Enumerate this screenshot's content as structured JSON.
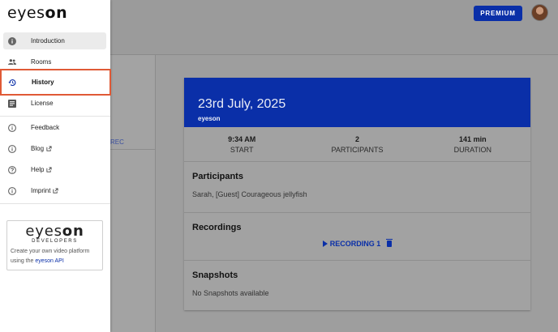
{
  "header": {
    "premium_label": "PREMIUM"
  },
  "background": {
    "rec_label": "REC"
  },
  "logo": {
    "prefix": "eyes",
    "suffix": "on"
  },
  "sidebar": {
    "items": [
      {
        "label": "Introduction",
        "icon": "info-filled-icon",
        "active": true
      },
      {
        "label": "Rooms",
        "icon": "people-icon"
      },
      {
        "label": "History",
        "icon": "history-icon",
        "highlighted": true
      },
      {
        "label": "License",
        "icon": "license-icon"
      },
      {
        "label": "Feedback",
        "icon": "info-outline-icon"
      },
      {
        "label": "Blog",
        "icon": "info-outline-icon",
        "external": true
      },
      {
        "label": "Help",
        "icon": "help-icon",
        "external": true
      },
      {
        "label": "Imprint",
        "icon": "info-outline-icon",
        "external": true
      }
    ],
    "highlight_color": "#e05a36"
  },
  "developers": {
    "logo_prefix": "eyes",
    "logo_suffix": "on",
    "subtitle": "DEVELOPERS",
    "text_line1": "Create your own video platform",
    "text_prefix": "using the ",
    "link": "eyeson API"
  },
  "meeting": {
    "date": "23rd July, 2025",
    "org": "eyeson",
    "stats": [
      {
        "value": "9:34 AM",
        "label": "START"
      },
      {
        "value": "2",
        "label": "PARTICIPANTS"
      },
      {
        "value": "141 min",
        "label": "DURATION"
      }
    ],
    "participants_title": "Participants",
    "participants_text": "Sarah, [Guest] Courageous jellyfish",
    "recordings_title": "Recordings",
    "recording_label": "RECORDING 1",
    "snapshots_title": "Snapshots",
    "snapshots_text": "No Snapshots available",
    "accent_color": "#0a2fa8"
  }
}
